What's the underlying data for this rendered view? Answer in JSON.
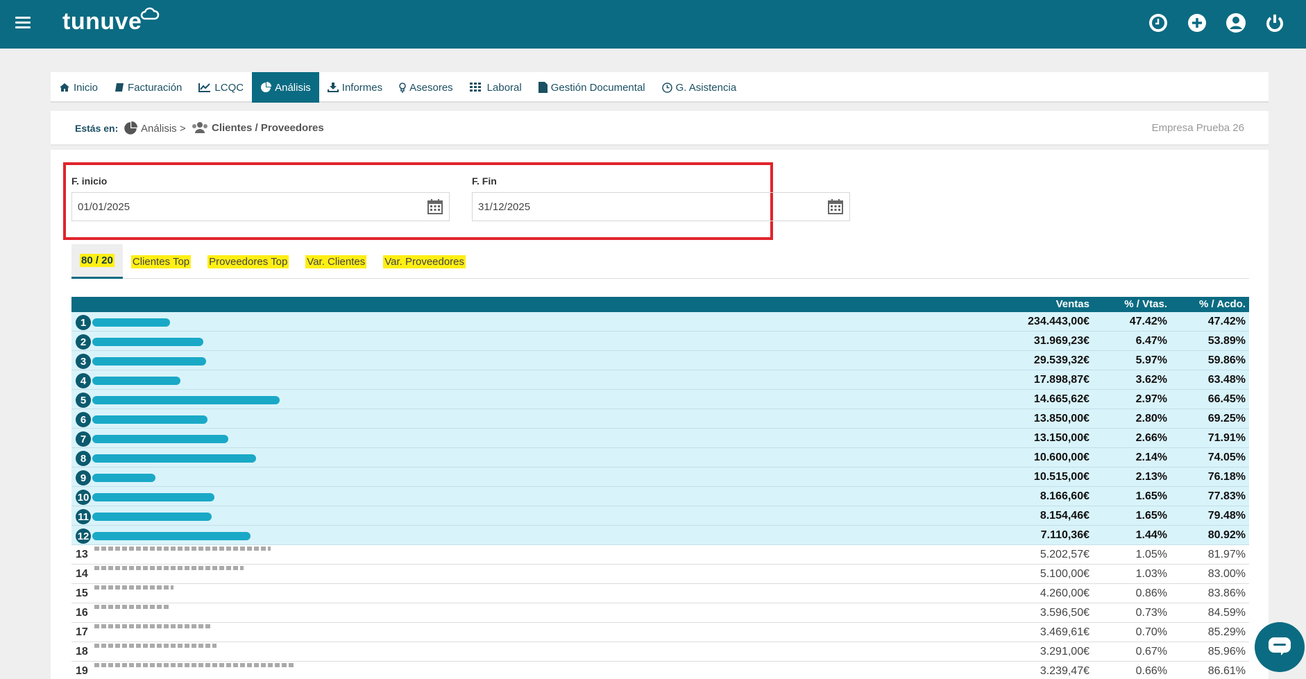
{
  "header": {
    "logo": "tunuve"
  },
  "nav": {
    "items": [
      {
        "label": "Inicio",
        "icon": "home-icon"
      },
      {
        "label": "Facturación",
        "icon": "book-icon"
      },
      {
        "label": "LCQC",
        "icon": "line-chart-icon"
      },
      {
        "label": "Análisis",
        "icon": "pie-chart-icon",
        "active": true
      },
      {
        "label": "Informes",
        "icon": "download-icon"
      },
      {
        "label": "Asesores",
        "icon": "lightbulb-icon"
      },
      {
        "label": "Laboral",
        "icon": "grid-icon"
      },
      {
        "label": "Gestión Documental",
        "icon": "document-icon"
      },
      {
        "label": "G. Asistencia",
        "icon": "clock-icon"
      }
    ]
  },
  "breadcrumb": {
    "label": "Estás en:",
    "section": "Análisis >",
    "page": "Clientes / Proveedores",
    "company": "Empresa Prueba 26"
  },
  "filters": {
    "start_label": "F. inicio",
    "start_value": "01/01/2025",
    "end_label": "F. Fin",
    "end_value": "31/12/2025"
  },
  "subtabs": [
    "80 / 20",
    "Clientes Top",
    "Proveedores Top",
    "Var. Clientes",
    "Var. Proveedores"
  ],
  "table": {
    "headers": {
      "ventas": "Ventas",
      "pct_vtas": "% / Vtas.",
      "pct_acdo": "% / Acdo."
    },
    "rows": [
      {
        "rank": "1",
        "ventas": "234.443,00€",
        "pct": "47.42%",
        "acum": "47.42%",
        "top": true
      },
      {
        "rank": "2",
        "ventas": "31.969,23€",
        "pct": "6.47%",
        "acum": "53.89%",
        "top": true
      },
      {
        "rank": "3",
        "ventas": "29.539,32€",
        "pct": "5.97%",
        "acum": "59.86%",
        "top": true
      },
      {
        "rank": "4",
        "ventas": "17.898,87€",
        "pct": "3.62%",
        "acum": "63.48%",
        "top": true
      },
      {
        "rank": "5",
        "ventas": "14.665,62€",
        "pct": "2.97%",
        "acum": "66.45%",
        "top": true
      },
      {
        "rank": "6",
        "ventas": "13.850,00€",
        "pct": "2.80%",
        "acum": "69.25%",
        "top": true
      },
      {
        "rank": "7",
        "ventas": "13.150,00€",
        "pct": "2.66%",
        "acum": "71.91%",
        "top": true
      },
      {
        "rank": "8",
        "ventas": "10.600,00€",
        "pct": "2.14%",
        "acum": "74.05%",
        "top": true
      },
      {
        "rank": "9",
        "ventas": "10.515,00€",
        "pct": "2.13%",
        "acum": "76.18%",
        "top": true
      },
      {
        "rank": "10",
        "ventas": "8.166,60€",
        "pct": "1.65%",
        "acum": "77.83%",
        "top": true
      },
      {
        "rank": "11",
        "ventas": "8.154,46€",
        "pct": "1.65%",
        "acum": "79.48%",
        "top": true
      },
      {
        "rank": "12",
        "ventas": "7.110,36€",
        "pct": "1.44%",
        "acum": "80.92%",
        "top": true
      },
      {
        "rank": "13",
        "ventas": "5.202,57€",
        "pct": "1.05%",
        "acum": "81.97%",
        "top": false
      },
      {
        "rank": "14",
        "ventas": "5.100,00€",
        "pct": "1.03%",
        "acum": "83.00%",
        "top": false
      },
      {
        "rank": "15",
        "ventas": "4.260,00€",
        "pct": "0.86%",
        "acum": "83.86%",
        "top": false
      },
      {
        "rank": "16",
        "ventas": "3.596,50€",
        "pct": "0.73%",
        "acum": "84.59%",
        "top": false
      },
      {
        "rank": "17",
        "ventas": "3.469,61€",
        "pct": "0.70%",
        "acum": "85.29%",
        "top": false
      },
      {
        "rank": "18",
        "ventas": "3.291,00€",
        "pct": "0.67%",
        "acum": "85.96%",
        "top": false
      },
      {
        "rank": "19",
        "ventas": "3.239,47€",
        "pct": "0.66%",
        "acum": "86.61%",
        "top": false
      }
    ]
  },
  "colors": {
    "primary": "#0b6b82",
    "highlight_row": "#d9f3fa",
    "tab_highlight": "#ffef14",
    "filter_border": "#e0242c"
  }
}
